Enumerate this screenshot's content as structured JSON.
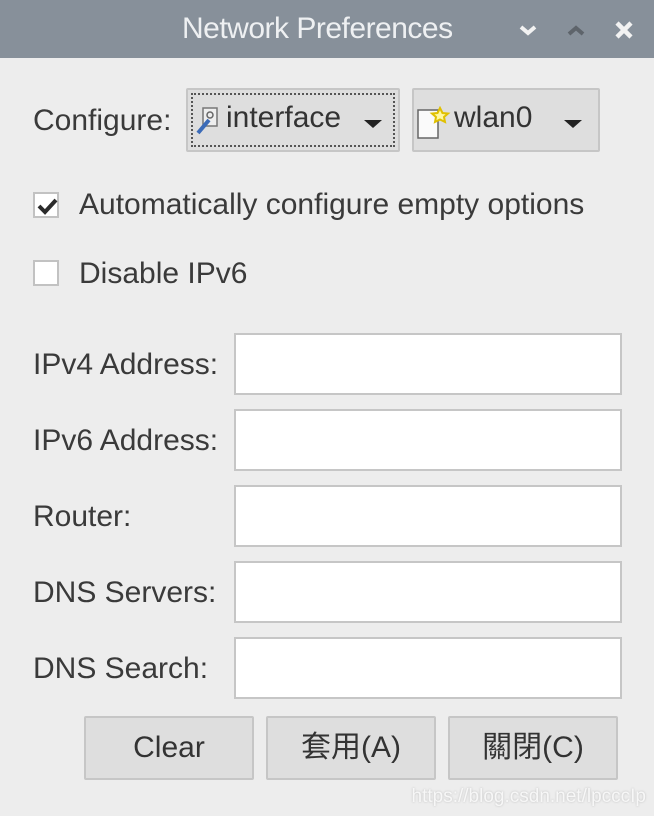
{
  "window": {
    "title": "Network Preferences",
    "controls": [
      "minimize-icon",
      "maximize-icon",
      "close-icon"
    ]
  },
  "configure": {
    "label": "Configure:",
    "type_select": {
      "value": "interface",
      "icon": "interface-icon"
    },
    "device_select": {
      "value": "wlan0",
      "icon": "new-document-icon"
    }
  },
  "options": {
    "auto_configure": {
      "label": "Automatically configure empty options",
      "checked": true
    },
    "disable_ipv6": {
      "label": "Disable IPv6",
      "checked": false
    }
  },
  "fields": [
    {
      "label": "IPv4 Address:",
      "value": ""
    },
    {
      "label": "IPv6 Address:",
      "value": ""
    },
    {
      "label": "Router:",
      "value": ""
    },
    {
      "label": "DNS Servers:",
      "value": ""
    },
    {
      "label": "DNS Search:",
      "value": ""
    }
  ],
  "buttons": {
    "clear": "Clear",
    "apply": "套用(A)",
    "close": "關閉(C)"
  },
  "watermark": "https://blog.csdn.net/lpcccIp"
}
